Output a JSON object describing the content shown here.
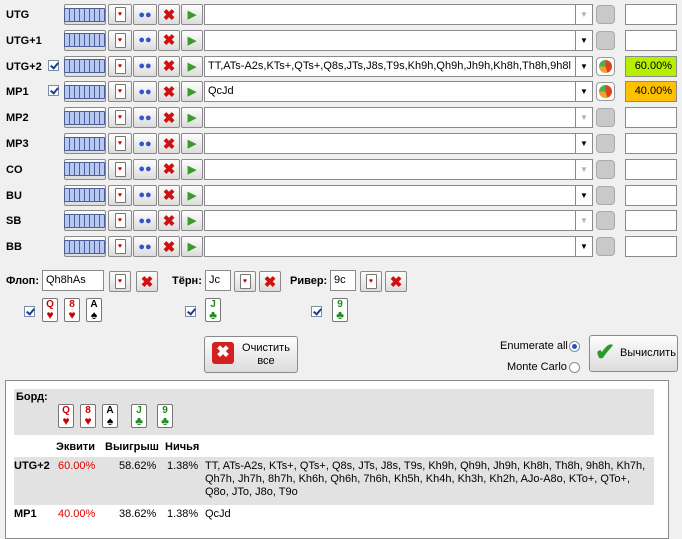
{
  "players": [
    {
      "pos": "UTG",
      "checked": false,
      "range": "",
      "equity": "",
      "dd_enabled": false,
      "pie": false
    },
    {
      "pos": "UTG+1",
      "checked": false,
      "range": "",
      "equity": "",
      "dd_enabled": true,
      "pie": false
    },
    {
      "pos": "UTG+2",
      "checked": true,
      "range": "TT, ATs-A2s, KTs+, QTs+, Q8s, JTs, J8s, T9s, Kh9h, Qh9h, Jh9h, Kh8h, Th8h, 9h8h",
      "range_short": "TT,ATs-A2s,KTs+,QTs+,Q8s,JTs,J8s,T9s,Kh9h,Qh9h,Jh9h,Kh8h,Th8h,9h8l",
      "equity": "60.00%",
      "equity_color": "#b6f000",
      "dd_enabled": true,
      "pie": true
    },
    {
      "pos": "MP1",
      "checked": true,
      "range": "QcJd",
      "range_short": "QcJd",
      "equity": "40.00%",
      "equity_color": "#ffc000",
      "dd_enabled": true,
      "pie": true
    },
    {
      "pos": "MP2",
      "checked": false,
      "range": "",
      "equity": "",
      "dd_enabled": false,
      "pie": false
    },
    {
      "pos": "MP3",
      "checked": false,
      "range": "",
      "equity": "",
      "dd_enabled": true,
      "pie": false
    },
    {
      "pos": "CO",
      "checked": false,
      "range": "",
      "equity": "",
      "dd_enabled": false,
      "pie": false
    },
    {
      "pos": "BU",
      "checked": false,
      "range": "",
      "equity": "",
      "dd_enabled": true,
      "pie": false
    },
    {
      "pos": "SB",
      "checked": false,
      "range": "",
      "equity": "",
      "dd_enabled": false,
      "pie": false
    },
    {
      "pos": "BB",
      "checked": false,
      "range": "",
      "equity": "",
      "dd_enabled": true,
      "pie": false
    }
  ],
  "board": {
    "flop_label": "Флоп:",
    "flop_value": "Qh8hAs",
    "turn_label": "Тёрн:",
    "turn_value": "Jc",
    "river_label": "Ривер:",
    "river_value": "9c",
    "flop_cards": [
      {
        "rank": "Q",
        "suit": "♥",
        "color": "red"
      },
      {
        "rank": "8",
        "suit": "♥",
        "color": "red"
      },
      {
        "rank": "A",
        "suit": "♠",
        "color": "blk"
      }
    ],
    "turn_card": {
      "rank": "J",
      "suit": "♣",
      "color": "grn"
    },
    "river_card": {
      "rank": "9",
      "suit": "♣",
      "color": "grn"
    }
  },
  "actions": {
    "clear_label_1": "Очистить",
    "clear_label_2": "все",
    "calc_label": "Вычислить",
    "enumerate_label": "Enumerate all",
    "montecarlo_label": "Monte Carlo"
  },
  "results": {
    "board_label": "Борд:",
    "headers": {
      "equity": "Эквити",
      "win": "Выигрыш",
      "tie": "Ничья"
    },
    "rows": [
      {
        "pos": "UTG+2",
        "equity": "60.00%",
        "win": "58.62%",
        "tie": "1.38%",
        "hand": "TT, ATs-A2s, KTs+, QTs+, Q8s, JTs, J8s, T9s, Kh9h, Qh9h, Jh9h, Kh8h, Th8h, 9h8h, Kh7h, Qh7h, Jh7h, 8h7h, Kh6h, Qh6h, 7h6h, Kh5h, Kh4h, Kh3h, Kh2h, AJo-A8o, KTo+, QTo+, Q8o, JTo, J8o, T9o"
      },
      {
        "pos": "MP1",
        "equity": "40.00%",
        "win": "38.62%",
        "tie": "1.38%",
        "hand": "QcJd"
      }
    ]
  },
  "colors": {
    "equity_red": "#e00000"
  }
}
